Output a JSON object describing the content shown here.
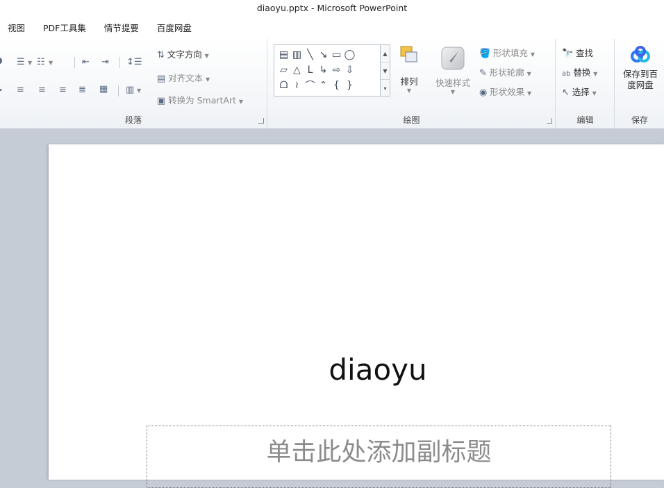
{
  "window": {
    "title": "diaoyu.pptx - Microsoft PowerPoint"
  },
  "tabs": [
    "视图",
    "PDF工具集",
    "情节提要",
    "百度网盘"
  ],
  "groups": {
    "paragraph": {
      "label": "段落",
      "text_direction": "文字方向",
      "align_text": "对齐文本",
      "convert_smartart": "转换为 SmartArt"
    },
    "drawing": {
      "label": "绘图",
      "arrange": "排列",
      "quick_styles": "快速样式",
      "shape_fill": "形状填充",
      "shape_outline": "形状轮廓",
      "shape_effects": "形状效果",
      "shapes": [
        "▤",
        "▥",
        "╲",
        "↘",
        "▭",
        "◯",
        "▱",
        "△",
        "ᒪ",
        "↳",
        "⇨",
        "⇩",
        "ᗝ",
        "≀",
        "⌒",
        "⌃",
        "{",
        "}"
      ]
    },
    "editing": {
      "label": "编辑",
      "find": "查找",
      "replace": "替换",
      "select": "选择"
    },
    "save": {
      "label": "保存",
      "save_to_baidu_line1": "保存到百",
      "save_to_baidu_line2": "度网盘"
    }
  },
  "slide": {
    "title": "diaoyu",
    "subtitle_placeholder": "单击此处添加副标题"
  },
  "colors": {
    "accent_baidu": "#2a7af0",
    "workspace_bg": "#c6ccd5"
  }
}
